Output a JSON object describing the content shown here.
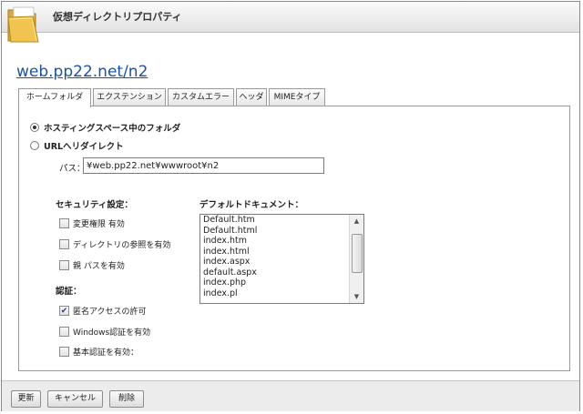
{
  "window": {
    "title": "仮想ディレクトリプロパティ",
    "host": "web.pp22.net/n2"
  },
  "tabs": [
    {
      "label": "ホームフォルダ",
      "active": true
    },
    {
      "label": "エクステンション",
      "active": false
    },
    {
      "label": "カスタムエラー",
      "active": false
    },
    {
      "label": "ヘッダ",
      "active": false
    },
    {
      "label": "MIMEタイプ",
      "active": false
    }
  ],
  "home": {
    "radio_hosting": "ホスティングスペース中のフォルダ",
    "radio_url": "URLへリダイレクト",
    "path_label": "パス：",
    "path_value": "¥web.pp22.net¥wwwroot¥n2"
  },
  "security": {
    "label": "セキュリティ設定：",
    "items": [
      {
        "label": "変更権限 有効",
        "checked": false
      },
      {
        "label": "ディレクトリの参照を有効",
        "checked": false
      },
      {
        "label": "親 パスを有効",
        "checked": false
      }
    ]
  },
  "auth": {
    "label": "認証：",
    "items": [
      {
        "label": "匿名アクセスの許可",
        "checked": true
      },
      {
        "label": "Windows認証を有効",
        "checked": false
      },
      {
        "label": "基本認証を有効：",
        "checked": false
      }
    ]
  },
  "default_docs": {
    "label": "デフォルトドキュメント：",
    "items": [
      "Default.htm",
      "Default.html",
      "index.htm",
      "index.html",
      "index.aspx",
      "default.aspx",
      "index.php",
      "index.pl"
    ]
  },
  "footer": {
    "update": "更新",
    "cancel": "キャンセル",
    "delete": "削除"
  }
}
